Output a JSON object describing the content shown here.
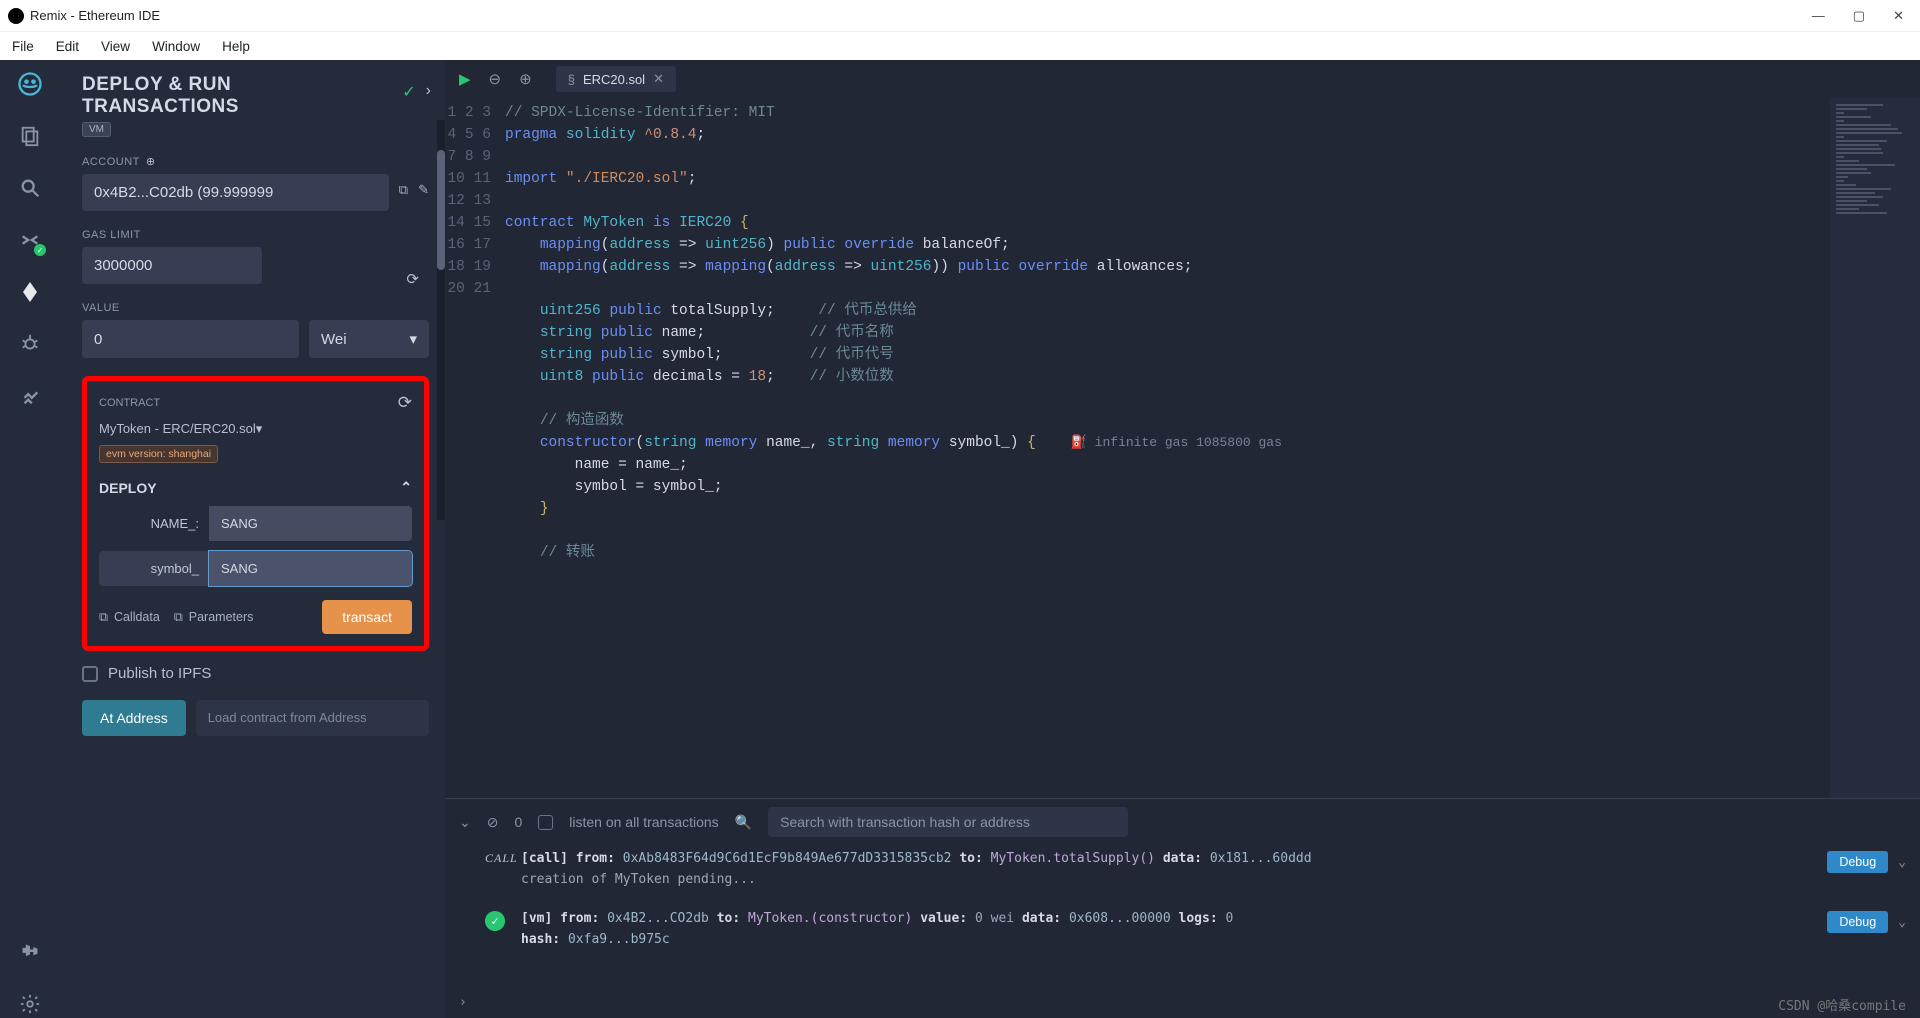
{
  "window": {
    "title": "Remix - Ethereum IDE"
  },
  "menubar": [
    "File",
    "Edit",
    "View",
    "Window",
    "Help"
  ],
  "panel": {
    "title_l1": "DEPLOY & RUN",
    "title_l2": "TRANSACTIONS",
    "vm_badge": "VM",
    "account_label": "ACCOUNT",
    "account_value": "0x4B2...C02db (99.999999",
    "gas_label": "GAS LIMIT",
    "gas_value": "3000000",
    "value_label": "VALUE",
    "value_value": "0",
    "value_unit": "Wei",
    "contract_label": "CONTRACT",
    "contract_value": "MyToken - ERC/ERC20.sol",
    "evm_tag": "evm version: shanghai",
    "deploy_label": "DEPLOY",
    "param1_label": "NAME_:",
    "param1_value": "SANG",
    "param2_label": "symbol_",
    "param2_value": "SANG",
    "calldata_label": "Calldata",
    "parameters_label": "Parameters",
    "transact_label": "transact",
    "ipfs_label": "Publish to IPFS",
    "ataddress_label": "At Address",
    "loadaddr_placeholder": "Load contract from Address"
  },
  "editor": {
    "tab_name": "ERC20.sol",
    "gas_hint_icon": "⛽",
    "gas_hint_text": "infinite gas 1085800 gas",
    "lines": [
      "// SPDX-License-Identifier: MIT",
      "pragma solidity ^0.8.4;",
      "",
      "import \"./IERC20.sol\";",
      "",
      "contract MyToken is IERC20 {",
      "    mapping(address => uint256) public override balanceOf;",
      "    mapping(address => mapping(address => uint256)) public override allowances;",
      "",
      "    uint256 public totalSupply;     // 代币总供给",
      "    string public name;             // 代币名称",
      "    string public symbol;           // 代币代号",
      "    uint8 public decimals = 18;     // 小数位数",
      "",
      "    // 构造函数",
      "    constructor(string memory name_, string memory symbol_) {",
      "        name = name_;",
      "        symbol = symbol_;",
      "    }",
      "",
      "    // 转账"
    ]
  },
  "terminal": {
    "count": "0",
    "listen_label": "listen on all transactions",
    "search_placeholder": "Search with transaction hash or address",
    "debug_label": "Debug",
    "rows": [
      {
        "kind": "call",
        "call_label": "[call]",
        "from_label": "from:",
        "from": "0xAb8483F64d9C6d1EcF9b849Ae677dD3315835cb2",
        "to_label": "to:",
        "to": "MyToken.totalSupply()",
        "data_label": "data:",
        "data": "0x181...60ddd",
        "pending": "creation of MyToken pending..."
      },
      {
        "kind": "vm",
        "call_label": "[vm]",
        "from_label": "from:",
        "from": "0x4B2...CO2db",
        "to_label": "to:",
        "to": "MyToken.(constructor)",
        "value_label": "value:",
        "value": "0 wei",
        "data_label": "data:",
        "data": "0x608...00000",
        "logs_label": "logs:",
        "logs": "0",
        "hash_label": "hash:",
        "hash": "0xfa9...b975c"
      }
    ]
  },
  "footer": "CSDN @哈桑compile"
}
